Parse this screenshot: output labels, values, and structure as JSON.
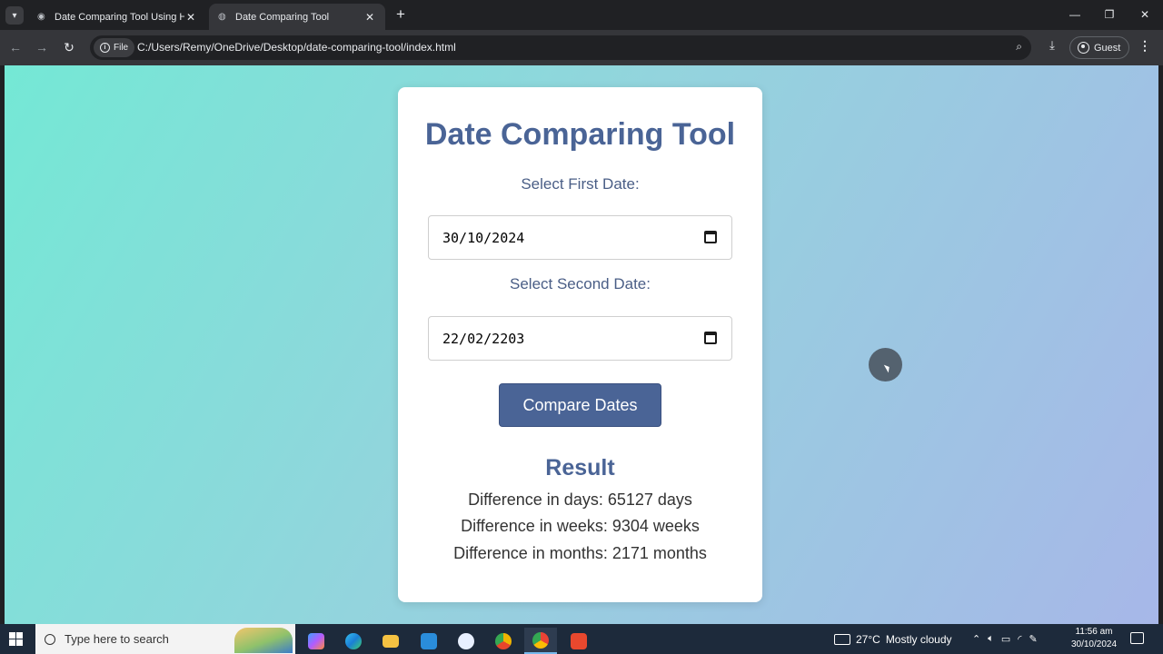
{
  "browser": {
    "tabs": [
      {
        "title": "Date Comparing Tool Using HTML",
        "active": false
      },
      {
        "title": "Date Comparing Tool",
        "active": true
      }
    ],
    "scheme_label": "File",
    "url": "C:/Users/Remy/OneDrive/Desktop/date-comparing-tool/index.html",
    "profile_label": "Guest"
  },
  "page": {
    "title": "Date Comparing Tool",
    "first_date_label": "Select First Date:",
    "first_date_value": "30/10/2024",
    "second_date_label": "Select Second Date:",
    "second_date_value": "22/02/2203",
    "compare_button": "Compare Dates",
    "result_heading": "Result",
    "result_days": "Difference in days: 65127 days",
    "result_weeks": "Difference in weeks: 9304 weeks",
    "result_months": "Difference in months: 2171 months",
    "colors": {
      "accent": "#4a6496",
      "gradient_start": "#74e8d5",
      "gradient_end": "#a7b7e8"
    }
  },
  "taskbar": {
    "search_placeholder": "Type here to search",
    "weather_temp": "27°C",
    "weather_text": "Mostly cloudy",
    "time": "11:56 am",
    "date": "30/10/2024",
    "apps": [
      "copilot-icon",
      "edge-icon",
      "file-explorer-icon",
      "vscode-icon",
      "app-store-icon",
      "chrome-canary-icon",
      "chrome-icon",
      "screen-recorder-icon"
    ]
  }
}
